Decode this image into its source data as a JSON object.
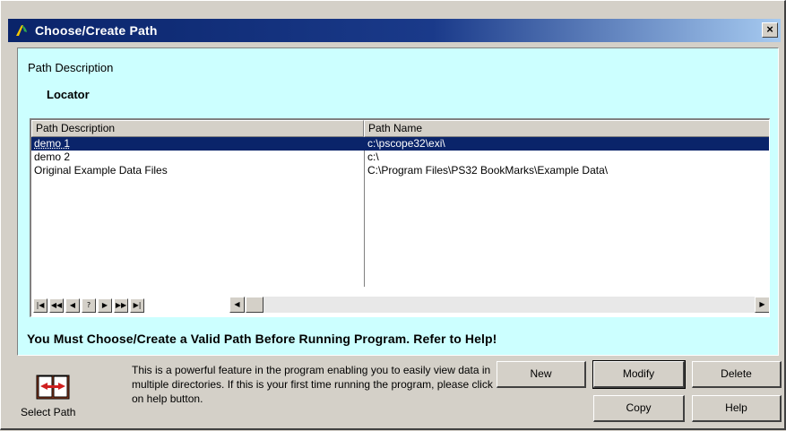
{
  "window": {
    "title": "Choose/Create Path",
    "close_glyph": "×"
  },
  "panel": {
    "section_label": "Path Description",
    "locator_label": "Locator",
    "columns": [
      "Path Description",
      "Path Name"
    ],
    "rows": [
      {
        "description": "demo 1",
        "path": "c:\\pscope32\\exi\\",
        "selected": true
      },
      {
        "description": "demo 2",
        "path": "c:\\",
        "selected": false
      },
      {
        "description": "Original Example Data Files",
        "path": "C:\\Program Files\\PS32 BookMarks\\Example Data\\",
        "selected": false
      }
    ],
    "nav_buttons": [
      "first-icon",
      "prev-page-icon",
      "prev-icon",
      "help-icon",
      "next-icon",
      "next-page-icon",
      "last-icon"
    ],
    "warning": "You Must Choose/Create a Valid Path Before Running Program. Refer to Help!"
  },
  "footer": {
    "select_path_label": "Select Path",
    "help_text": "This is a powerful feature in the program enabling you to easily view data in multiple directories. If this is your first time running the program, please click on help button.",
    "buttons": {
      "new": "New",
      "modify": "Modify",
      "delete": "Delete",
      "copy": "Copy",
      "help": "Help"
    }
  },
  "colors": {
    "title_bar": "#0a246a",
    "panel_bg": "#ccffff",
    "selection": "#0a246a",
    "face": "#d4d0c8"
  }
}
